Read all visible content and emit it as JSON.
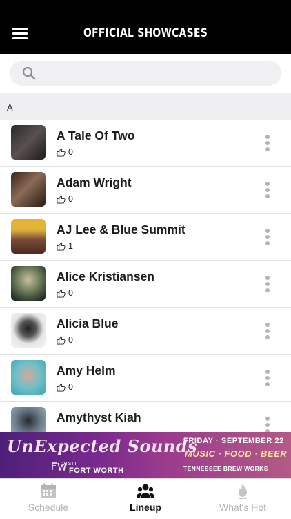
{
  "header": {
    "title": "OFFICIAL SHOWCASES"
  },
  "search": {
    "placeholder": ""
  },
  "section": {
    "letter": "A"
  },
  "artists": [
    {
      "name": "A Tale Of Two",
      "likes": "0"
    },
    {
      "name": "Adam Wright",
      "likes": "0"
    },
    {
      "name": "AJ Lee & Blue Summit",
      "likes": "1"
    },
    {
      "name": "Alice Kristiansen",
      "likes": "0"
    },
    {
      "name": "Alicia Blue",
      "likes": "0"
    },
    {
      "name": "Amy Helm",
      "likes": "0"
    },
    {
      "name": "Amythyst Kiah",
      "likes": ""
    }
  ],
  "banner": {
    "title": "UnExpected Sounds",
    "visit": "VISIT",
    "city": "FORT WORTH",
    "date": "FRIDAY · SEPTEMBER 22",
    "tagline": "MUSIC · FOOD · BEER",
    "sponsor": "TENNESSEE BREW WORKS"
  },
  "tabs": [
    {
      "label": "Schedule",
      "icon": "calendar-icon",
      "active": false
    },
    {
      "label": "Lineup",
      "icon": "people-icon",
      "active": true
    },
    {
      "label": "What's Hot",
      "icon": "flame-icon",
      "active": false
    }
  ],
  "colors": {
    "header_bg": "#000000",
    "active_tab": "#111111",
    "inactive_tab": "#b4b4b8",
    "banner_accent": "#f8e39a"
  }
}
